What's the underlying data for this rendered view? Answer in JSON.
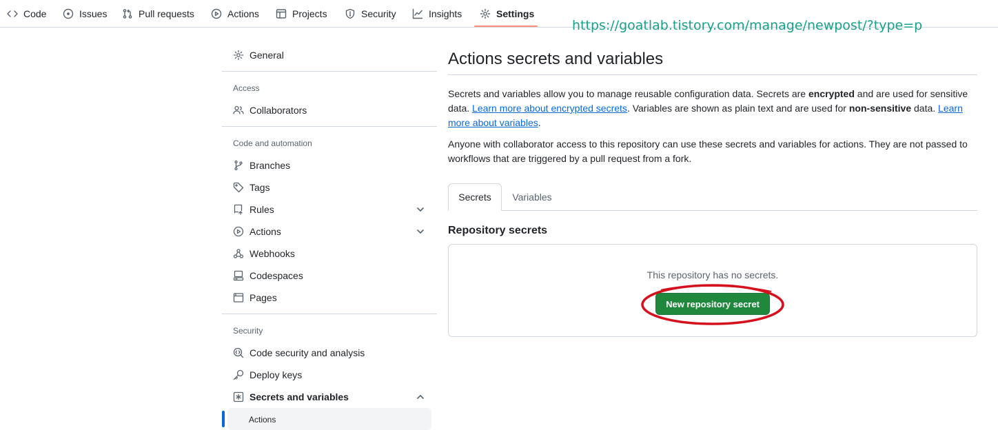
{
  "topnav": {
    "tabs": [
      {
        "label": "Code",
        "icon": "code-icon"
      },
      {
        "label": "Issues",
        "icon": "issue-opened-icon"
      },
      {
        "label": "Pull requests",
        "icon": "git-pull-request-icon"
      },
      {
        "label": "Actions",
        "icon": "play-icon"
      },
      {
        "label": "Projects",
        "icon": "table-icon"
      },
      {
        "label": "Security",
        "icon": "shield-icon"
      },
      {
        "label": "Insights",
        "icon": "graph-icon"
      },
      {
        "label": "Settings",
        "icon": "gear-icon"
      }
    ],
    "active": "Settings",
    "accent_color": "#fd8c73"
  },
  "watermark": "https://goatlab.tistory.com/manage/newpost/?type=p",
  "sidebar": {
    "general": "General",
    "sections": {
      "access": "Access",
      "code_automation": "Code and automation",
      "security": "Security"
    },
    "items": {
      "collaborators": "Collaborators",
      "branches": "Branches",
      "tags": "Tags",
      "rules": "Rules",
      "actions": "Actions",
      "webhooks": "Webhooks",
      "codespaces": "Codespaces",
      "pages": "Pages",
      "code_security": "Code security and analysis",
      "deploy_keys": "Deploy keys",
      "secrets_variables": "Secrets and variables",
      "secrets_actions": "Actions"
    }
  },
  "main": {
    "title": "Actions secrets and variables",
    "intro": {
      "t1": "Secrets and variables allow you to manage reusable configuration data. Secrets are ",
      "b1": "encrypted",
      "t2": " and are used for sensitive data. ",
      "link1": "Learn more about encrypted secrets",
      "t3": ". Variables are shown as plain text and are used for ",
      "b2": "non-sensitive",
      "t4": " data. ",
      "link2": "Learn more about variables",
      "t5": "."
    },
    "access_note": "Anyone with collaborator access to this repository can use these secrets and variables for actions. They are not passed to workflows that are triggered by a pull request from a fork.",
    "tabs": {
      "secrets": "Secrets",
      "variables": "Variables"
    },
    "repo_secrets_title": "Repository secrets",
    "empty_message": "This repository has no secrets.",
    "new_secret_button": "New repository secret",
    "button_color": "#1f883d",
    "highlight_color": "#d4111d"
  }
}
